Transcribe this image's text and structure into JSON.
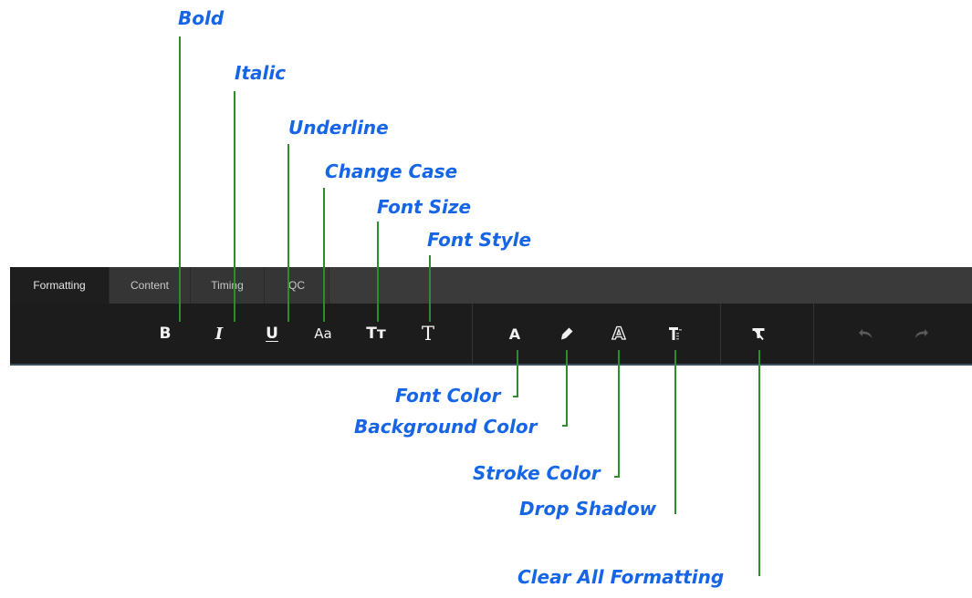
{
  "tabs": [
    {
      "label": "Formatting",
      "active": true
    },
    {
      "label": "Content",
      "active": false
    },
    {
      "label": "Timing",
      "active": false
    },
    {
      "label": "QC",
      "active": false
    }
  ],
  "toolbar": {
    "buttons": [
      {
        "icon": "bold-icon",
        "glyph": "B"
      },
      {
        "icon": "italic-icon",
        "glyph": "I"
      },
      {
        "icon": "underline-icon",
        "glyph": "U"
      },
      {
        "icon": "change-case-icon",
        "glyph": "Aa"
      },
      {
        "icon": "font-size-icon",
        "glyph": "Tт"
      },
      {
        "icon": "font-style-icon",
        "glyph": "T"
      },
      {
        "icon": "font-color-icon",
        "glyph": "A"
      },
      {
        "icon": "background-color-icon"
      },
      {
        "icon": "stroke-color-icon",
        "glyph": "A"
      },
      {
        "icon": "drop-shadow-icon"
      },
      {
        "icon": "clear-formatting-icon"
      },
      {
        "icon": "undo-icon",
        "disabled": true
      },
      {
        "icon": "redo-icon",
        "disabled": true
      }
    ]
  },
  "annotations": {
    "bold": "Bold",
    "italic": "Italic",
    "underline": "Underline",
    "change_case": "Change Case",
    "font_size": "Font Size",
    "font_style": "Font Style",
    "font_color": "Font Color",
    "background_color": "Background Color",
    "stroke_color": "Stroke Color",
    "drop_shadow": "Drop Shadow",
    "clear_all_formatting": "Clear All Formatting"
  },
  "colors": {
    "annotation_text": "#1565e6",
    "leader_line": "#2e8b2e",
    "toolbar_bg": "#1c1c1c",
    "tabbar_bg": "#3a3a3a"
  }
}
